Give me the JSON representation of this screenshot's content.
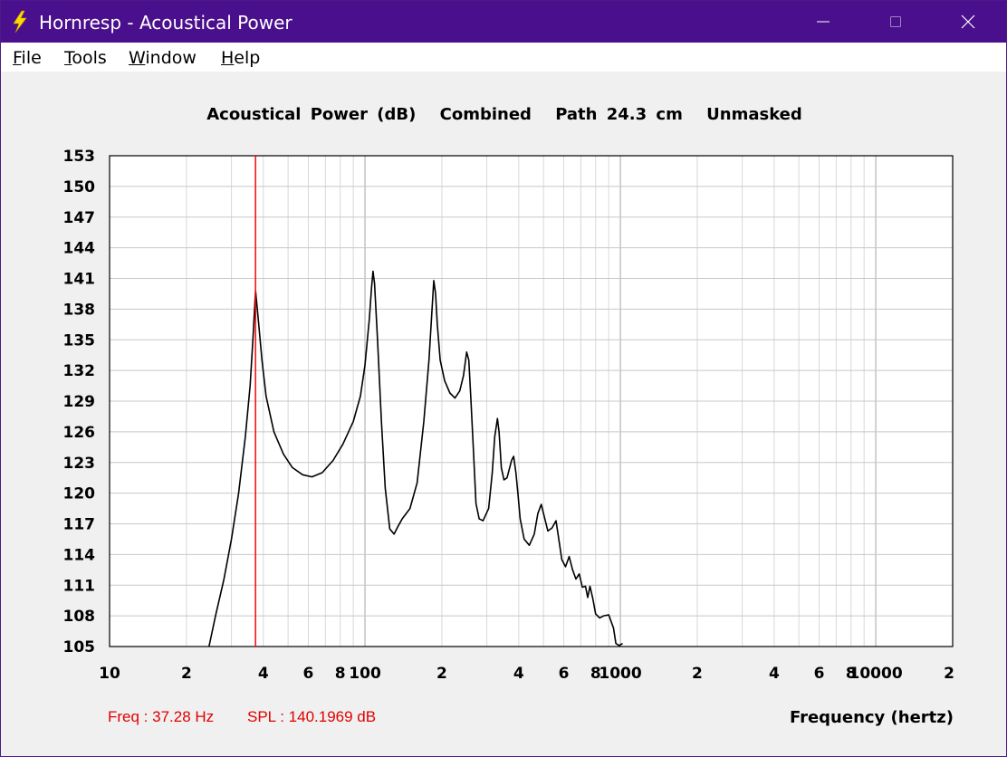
{
  "window": {
    "title": "Hornresp - Acoustical Power",
    "icon": "lightning-bolt-icon",
    "controls": [
      "minimize-icon",
      "maximize-icon",
      "close-icon"
    ]
  },
  "menu": {
    "items": [
      {
        "label": "File",
        "key": "F",
        "rest": "ile"
      },
      {
        "label": "Tools",
        "key": "T",
        "rest": "ools"
      },
      {
        "label": "Window",
        "key": "W",
        "rest": "indow"
      },
      {
        "label": "Help",
        "key": "H",
        "rest": "elp"
      }
    ]
  },
  "header": {
    "parts": [
      "Acoustical Power (dB)",
      "Combined",
      "Path 24.3 cm",
      "Unmasked"
    ]
  },
  "readout": {
    "freq": "Freq : 37.28 Hz",
    "spl": "SPL : 140.1969 dB"
  },
  "colors": {
    "titlebar": "#4a0f8c",
    "curve": "#000000",
    "cursor": "#ff0000",
    "grid": "#c8c8c8"
  },
  "chart_data": {
    "type": "line",
    "title": "Acoustical Power (dB)   Combined   Path 24.3 cm   Unmasked",
    "xlabel": "Frequency (hertz)",
    "ylabel": "",
    "x_scale": "log",
    "xlim": [
      10,
      20000
    ],
    "ylim": [
      105,
      153
    ],
    "grid": true,
    "yticks": [
      153,
      150,
      147,
      144,
      141,
      138,
      135,
      132,
      129,
      126,
      123,
      120,
      117,
      114,
      111,
      108,
      105
    ],
    "xtick_labels": [
      {
        "value": 10,
        "label": "10"
      },
      {
        "value": 20,
        "label": "2"
      },
      {
        "value": 40,
        "label": "4"
      },
      {
        "value": 60,
        "label": "6"
      },
      {
        "value": 80,
        "label": "8"
      },
      {
        "value": 100,
        "label": "100"
      },
      {
        "value": 200,
        "label": "2"
      },
      {
        "value": 400,
        "label": "4"
      },
      {
        "value": 600,
        "label": "6"
      },
      {
        "value": 800,
        "label": "8"
      },
      {
        "value": 1000,
        "label": "1000"
      },
      {
        "value": 2000,
        "label": "2"
      },
      {
        "value": 4000,
        "label": "4"
      },
      {
        "value": 6000,
        "label": "6"
      },
      {
        "value": 8000,
        "label": "8"
      },
      {
        "value": 10000,
        "label": "10000"
      },
      {
        "value": 20000,
        "label": "2"
      }
    ],
    "cursor": {
      "x": 37.28,
      "y": 140.1969
    },
    "series": [
      {
        "x": [
          24.5,
          26,
          28,
          30,
          32,
          34,
          35.5,
          36.5,
          37.3,
          38.2,
          39.5,
          41,
          44,
          48,
          52,
          57,
          62,
          68,
          75,
          82,
          90,
          96,
          100,
          104,
          106,
          107.5,
          109,
          112,
          116,
          120,
          125,
          130,
          135,
          140,
          150,
          160,
          170,
          178,
          183,
          186,
          189,
          192,
          197,
          205,
          215,
          225,
          235,
          243,
          250,
          255,
          260,
          266,
          272,
          280,
          290,
          305,
          315,
          322,
          330,
          335,
          338,
          342,
          350,
          360,
          375,
          382,
          390,
          397,
          405,
          420,
          440,
          460,
          475,
          490,
          500,
          520,
          540,
          560,
          570,
          590,
          610,
          630,
          650,
          670,
          690,
          710,
          730,
          745,
          760,
          780,
          800,
          830,
          860,
          900,
          940,
          960,
          990,
          1020
        ],
        "y": [
          105,
          108,
          111.5,
          115.5,
          120,
          125.5,
          130.5,
          135.5,
          139.8,
          137,
          133,
          129.5,
          126,
          123.8,
          122.5,
          121.8,
          121.6,
          122,
          123.2,
          124.8,
          127,
          129.5,
          132.5,
          137,
          140,
          141.7,
          140.5,
          135,
          127,
          120.5,
          116.5,
          116,
          116.8,
          117.5,
          118.5,
          121,
          127,
          133,
          138,
          140.8,
          139.5,
          136.5,
          133,
          131,
          129.8,
          129.3,
          130,
          131.5,
          133.8,
          133,
          129,
          124,
          119,
          117.5,
          117.3,
          118.5,
          122,
          125.5,
          127.3,
          126,
          124.5,
          122.5,
          121.3,
          121.5,
          123.2,
          123.6,
          122,
          120,
          117.5,
          115.5,
          114.9,
          116,
          118,
          118.9,
          118,
          116.3,
          116.6,
          117.3,
          116,
          113.5,
          112.8,
          113.8,
          112.5,
          111.6,
          112.1,
          110.8,
          110.9,
          109.8,
          110.9,
          109.7,
          108.2,
          107.8,
          108,
          108.1,
          106.8,
          105.3,
          105.1,
          105.3
        ]
      }
    ]
  }
}
